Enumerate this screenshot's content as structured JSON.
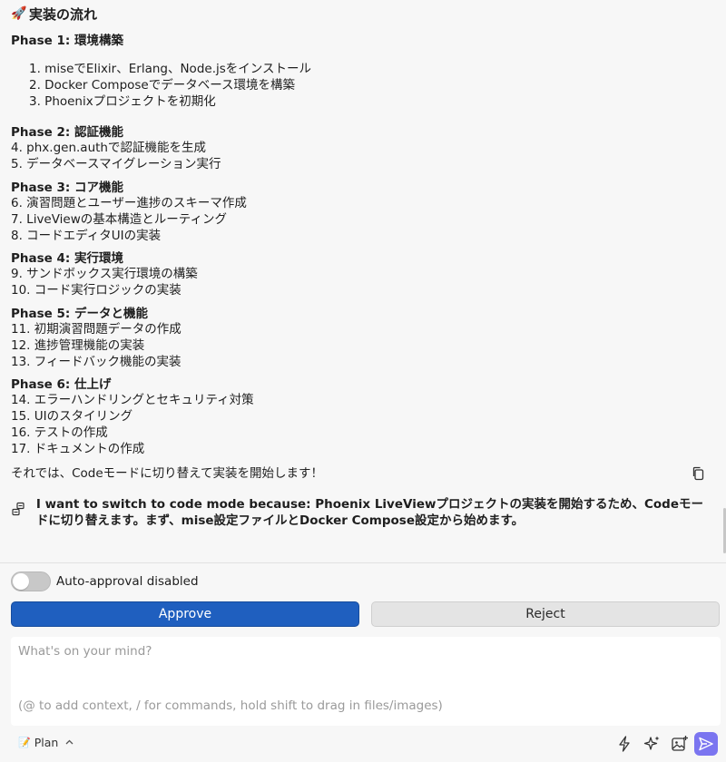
{
  "header": {
    "rocket_icon": "🚀",
    "title": "実装の流れ"
  },
  "phase1": {
    "title": "Phase 1: 環境構築",
    "items": [
      "1. miseでElixir、Erlang、Node.jsをインストール",
      "2. Docker Composeでデータベース環境を構築",
      "3. Phoenixプロジェクトを初期化"
    ]
  },
  "phases": [
    {
      "title": "Phase 2: 認証機能",
      "items": [
        "4. phx.gen.authで認証機能を生成",
        "5. データベースマイグレーション実行"
      ]
    },
    {
      "title": "Phase 3: コア機能",
      "items": [
        "6. 演習問題とユーザー進捗のスキーマ作成",
        "7. LiveViewの基本構造とルーティング",
        "8. コードエディタUIの実装"
      ]
    },
    {
      "title": "Phase 4: 実行環境",
      "items": [
        "9. サンドボックス実行環境の構築",
        "10. コード実行ロジックの実装"
      ]
    },
    {
      "title": "Phase 5: データと機能",
      "items": [
        "11. 初期演習問題データの作成",
        "12. 進捗管理機能の実装",
        "13. フィードバック機能の実装"
      ]
    },
    {
      "title": "Phase 6: 仕上げ",
      "items": [
        "14. エラーハンドリングとセキュリティ対策",
        "15. UIのスタイリング",
        "16. テストの作成",
        "17. ドキュメントの作成"
      ]
    }
  ],
  "closing": "それでは、Codeモードに切り替えて実装を開始します！",
  "mode_switch_message": "I want to switch to code mode because: Phoenix LiveViewプロジェクトの実装を開始するため、Codeモードに切り替えます。まず、mise設定ファイルとDocker Compose設定から始めます。",
  "panel": {
    "auto_approval_label": "Auto-approval disabled",
    "auto_approval_enabled": false,
    "approve_label": "Approve",
    "reject_label": "Reject",
    "input_value": "",
    "input_placeholder": "What's on your mind?",
    "input_hint": "(@ to add context, / for commands, hold shift to drag in files/images)",
    "mode_label": "Plan",
    "mode_icon": "📝"
  },
  "icons": {
    "copy": "copy-icon",
    "mode_switch": "mode-switch-icon",
    "bolt": "bolt-icon",
    "sparkle": "sparkle-icon",
    "image": "add-image-icon",
    "send": "send-icon"
  },
  "colors": {
    "approve": "#1f5fbf",
    "reject": "#e4e4e4",
    "send": "#7b75f0",
    "background": "#f7f7f7"
  }
}
